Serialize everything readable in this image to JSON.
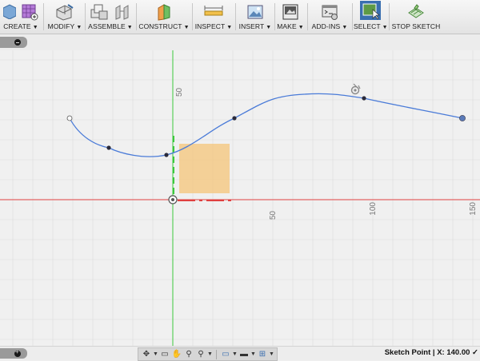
{
  "toolbar": {
    "groups": [
      {
        "label": "CREATE",
        "icon": "create-cube-icon"
      },
      {
        "label": "MODIFY",
        "icon": "modify-box-icon"
      },
      {
        "label": "ASSEMBLE",
        "icon": "assemble-blocks-icon"
      },
      {
        "label": "CONSTRUCT",
        "icon": "construct-plane-icon"
      },
      {
        "label": "INSPECT",
        "icon": "inspect-measure-icon"
      },
      {
        "label": "INSERT",
        "icon": "insert-image-icon"
      },
      {
        "label": "MAKE",
        "icon": "make-3dprint-icon"
      },
      {
        "label": "ADD-INS",
        "icon": "addins-script-icon"
      },
      {
        "label": "SELECT",
        "icon": "select-box-icon"
      },
      {
        "label": "STOP SKETCH",
        "icon": "stop-sketch-icon"
      }
    ]
  },
  "canvas": {
    "axis_labels": {
      "y_50": "50",
      "x_50": "50",
      "x_100": "100",
      "x_150": "150"
    },
    "colors": {
      "background": "#f0f0f0",
      "grid": "#dcdcdc",
      "x_axis": "#e04040",
      "y_axis": "#3cc83c",
      "spline": "#4a7bd8",
      "face": "#f5c77e"
    }
  },
  "navbar": {
    "icons": [
      "orbit-icon",
      "look-at-icon",
      "pan-icon",
      "zoom-icon",
      "fit-icon",
      "display-settings-icon",
      "visual-style-icon",
      "grid-settings-icon"
    ]
  },
  "status": {
    "text": "Sketch Point | X: 140.00 ✓"
  }
}
